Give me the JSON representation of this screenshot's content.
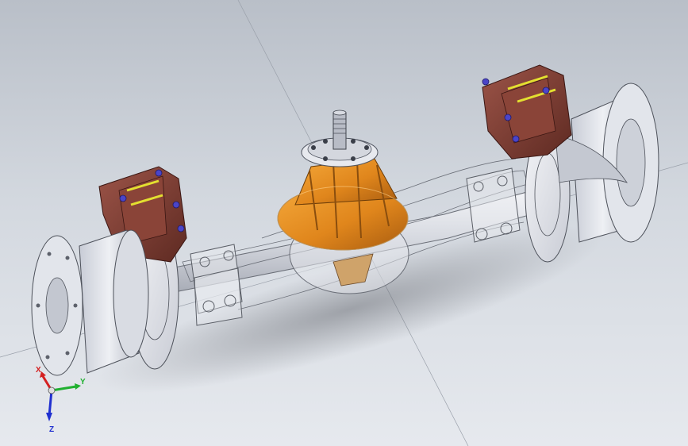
{
  "window": {
    "title": ""
  },
  "model": {
    "name": ""
  },
  "colors": {
    "background_top": "#b9bfc8",
    "background_bottom": "#e6e9ee",
    "caliper": "#7a3a30",
    "carrier": "#e08a1e",
    "wheel_hub": "#dfe2ea",
    "housing_outline": "#6b6f78",
    "bolt": "#4b45c8",
    "pin": "#e3e030"
  },
  "triad": {
    "x_label": "X",
    "y_label": "Y",
    "z_label": "Z",
    "x_color": "#d42020",
    "y_color": "#20b030",
    "z_color": "#2030d0"
  }
}
